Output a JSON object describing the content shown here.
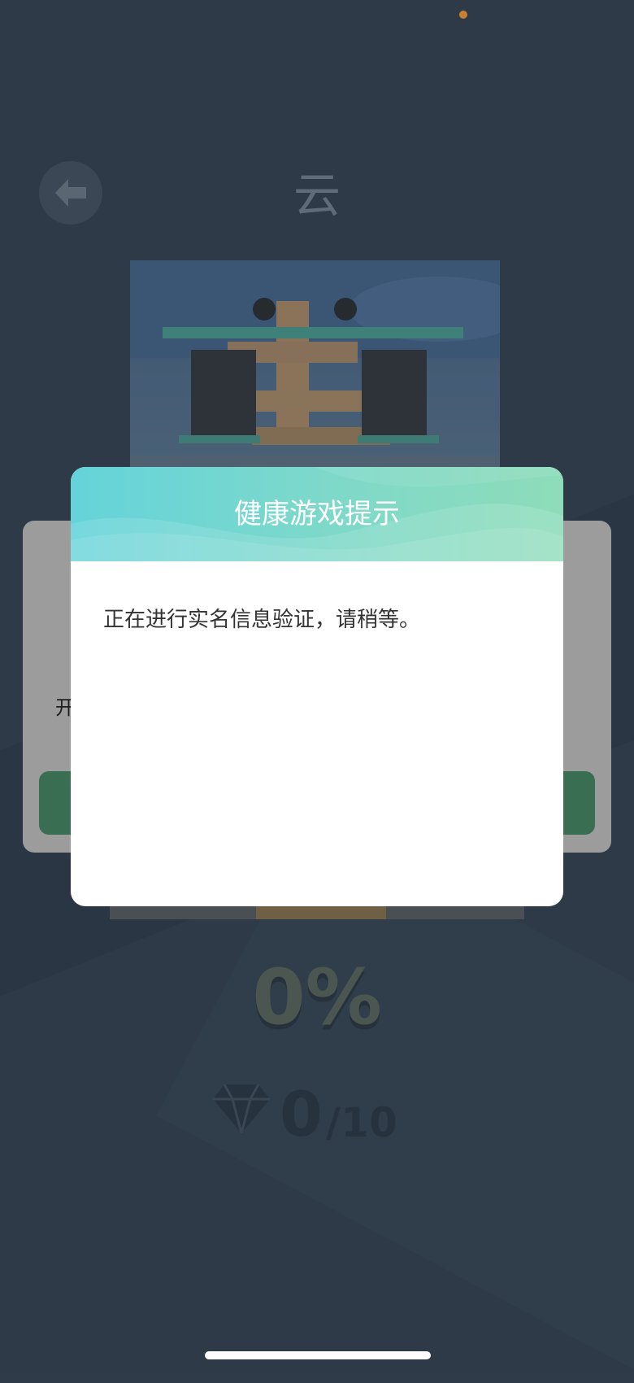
{
  "level": {
    "title": "云"
  },
  "background_panel": {
    "text": "开"
  },
  "stats": {
    "progress_percent": "0%",
    "gems_collected": "0",
    "gems_total": "/10"
  },
  "dialog": {
    "title": "健康游戏提示",
    "message": "正在进行实名信息验证，请稍等。"
  },
  "icons": [
    "back-arrow-icon",
    "diamond-icon"
  ],
  "colors": {
    "background": "#2f3b48",
    "dialog_header_start": "#64d3da",
    "dialog_header_end": "#8edcb9",
    "status_dot": "#c9812f"
  }
}
